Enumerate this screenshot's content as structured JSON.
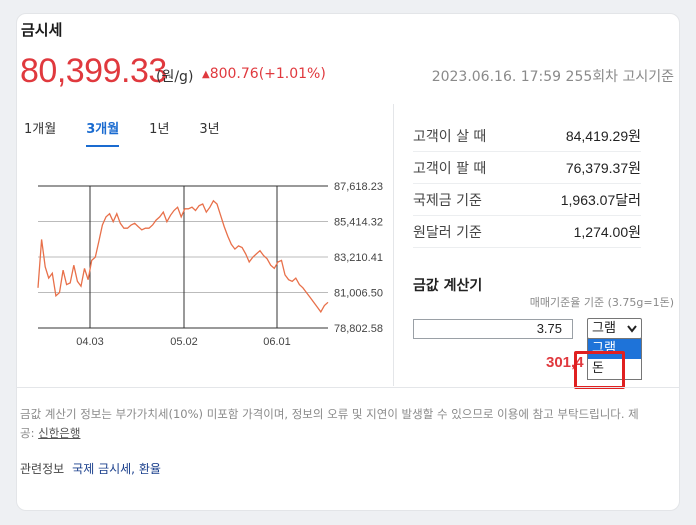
{
  "widget": {
    "title": "금시세",
    "price": "80,399.33",
    "unit": "(원/g)",
    "change_symbol": "▲",
    "change": "800.76(+1.01%)",
    "basis": "2023.06.16. 17:59 255회차 고시기준"
  },
  "tabs": [
    {
      "label": "1개월",
      "active": false
    },
    {
      "label": "3개월",
      "active": true
    },
    {
      "label": "1년",
      "active": false
    },
    {
      "label": "3년",
      "active": false
    }
  ],
  "chart_data": {
    "type": "line",
    "x_ticks": [
      "04.03",
      "05.02",
      "06.01"
    ],
    "y_ticks": [
      "87,618.23",
      "85,414.32",
      "83,210.41",
      "81,006.50",
      "78,802.58"
    ],
    "ylim": [
      78802.58,
      87618.23
    ],
    "grid": true,
    "color": "#e8704a",
    "values": [
      81300,
      84300,
      82600,
      81900,
      82200,
      80800,
      81000,
      82400,
      81500,
      81600,
      82700,
      81700,
      81400,
      82500,
      81800,
      83000,
      83200,
      84200,
      85200,
      85700,
      85900,
      85400,
      85900,
      85300,
      85000,
      85000,
      85200,
      85300,
      85100,
      84900,
      85000,
      85000,
      85200,
      85500,
      85700,
      86000,
      85400,
      85800,
      86100,
      86300,
      85700,
      86200,
      86200,
      86300,
      86100,
      86400,
      86500,
      86000,
      86300,
      86700,
      86500,
      85800,
      85100,
      84500,
      84000,
      83700,
      83900,
      83800,
      83400,
      82900,
      83200,
      83400,
      83600,
      83300,
      83100,
      82700,
      82500,
      82900,
      83000,
      82100,
      81800,
      81700,
      81900,
      81500,
      81300,
      81000,
      80700,
      80400,
      80100,
      79800,
      80200,
      80400
    ]
  },
  "info": [
    {
      "label": "고객이 살 때",
      "value": "84,419.29원"
    },
    {
      "label": "고객이 팔 때",
      "value": "76,379.37원"
    },
    {
      "label": "국제금 기준",
      "value": "1,963.07달러"
    },
    {
      "label": "원달러 기준",
      "value": "1,274.00원"
    }
  ],
  "calculator": {
    "title": "금값 계산기",
    "basis": "매매기준율 기준 (3.75g=1돈)",
    "input_value": "3.75",
    "selected_unit": "그램",
    "options": [
      "그램",
      "돈"
    ],
    "result": "301,4"
  },
  "notice": {
    "text": "금값 계산기 정보는 부가가치세(10%) 미포함 가격이며, 정보의 오류 및 지연이 발생할 수 있으므로 이용에 참고 부탁드립니다. 제공: ",
    "provider": "신한은행"
  },
  "related": {
    "label": "관련정보",
    "links": "국제 금시세, 환율"
  }
}
